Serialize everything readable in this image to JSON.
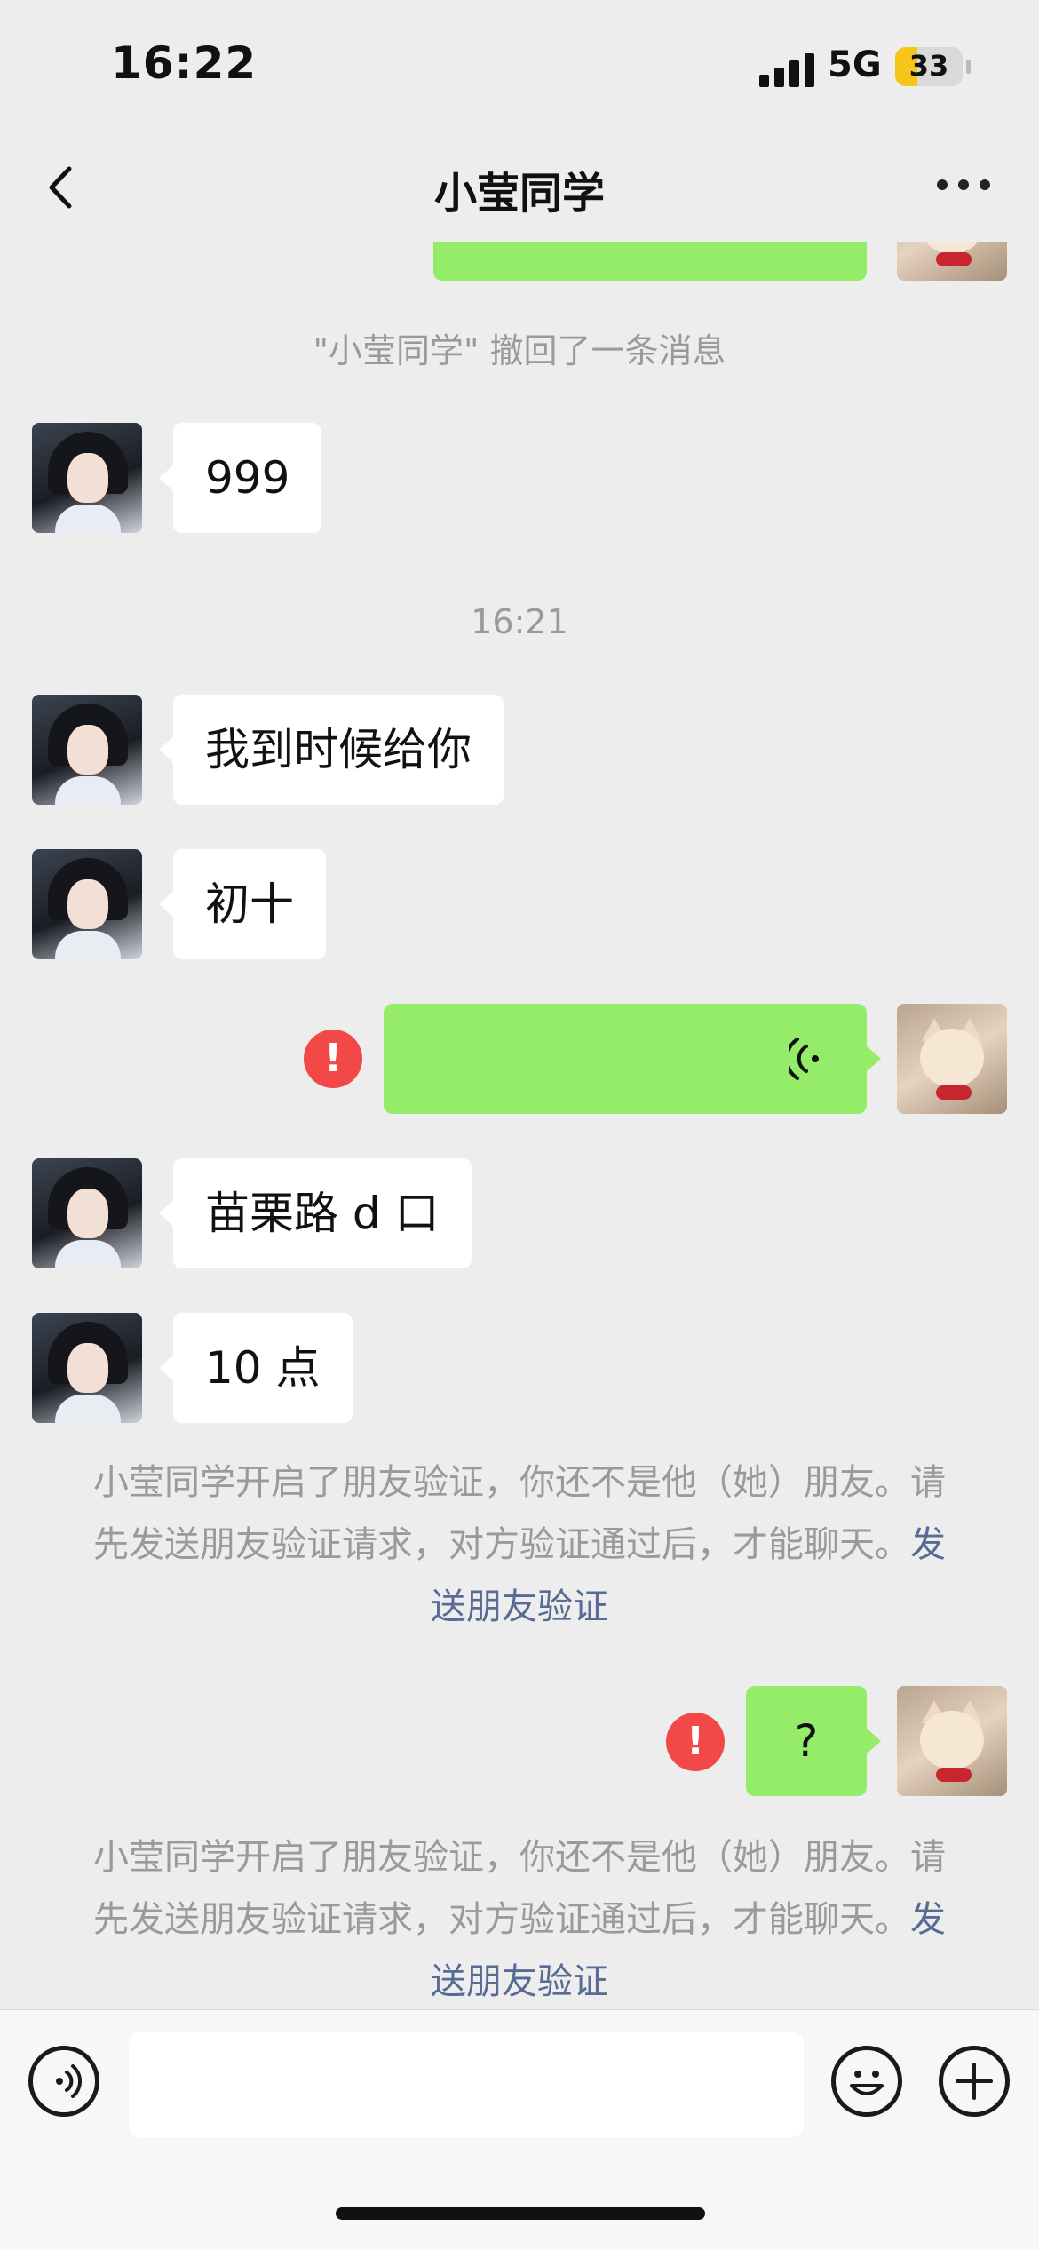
{
  "status_bar": {
    "time": "16:22",
    "network": "5G",
    "battery": "33",
    "battery_level": 0.33
  },
  "nav": {
    "title": "小莹同学",
    "back_icon": "chevron-left-icon",
    "more_icon": "ellipsis-icon"
  },
  "messages": {
    "recall_notice": "\"小莹同学\" 撤回了一条消息",
    "msg_999": "999",
    "time_divider": "16:21",
    "msg_give": "我到时候给你",
    "msg_chushi": "初十",
    "error_symbol": "!",
    "msg_miaoli": "苗栗路 d 口",
    "msg_10": "10 点",
    "msg_question": "?"
  },
  "verification": {
    "text": "小莹同学开启了朋友验证，你还不是他（她）朋友。请先发送朋友验证请求，对方验证通过后，才能聊天。",
    "link": "发送朋友验证"
  },
  "input_bar": {
    "voice_icon": "voice-icon",
    "emoji_icon": "emoji-icon",
    "plus_icon": "plus-icon"
  },
  "colors": {
    "outgoing_bubble": "#95ec69",
    "incoming_bubble": "#ffffff",
    "error": "#f24848",
    "link": "#576b95",
    "background": "#ededed"
  }
}
